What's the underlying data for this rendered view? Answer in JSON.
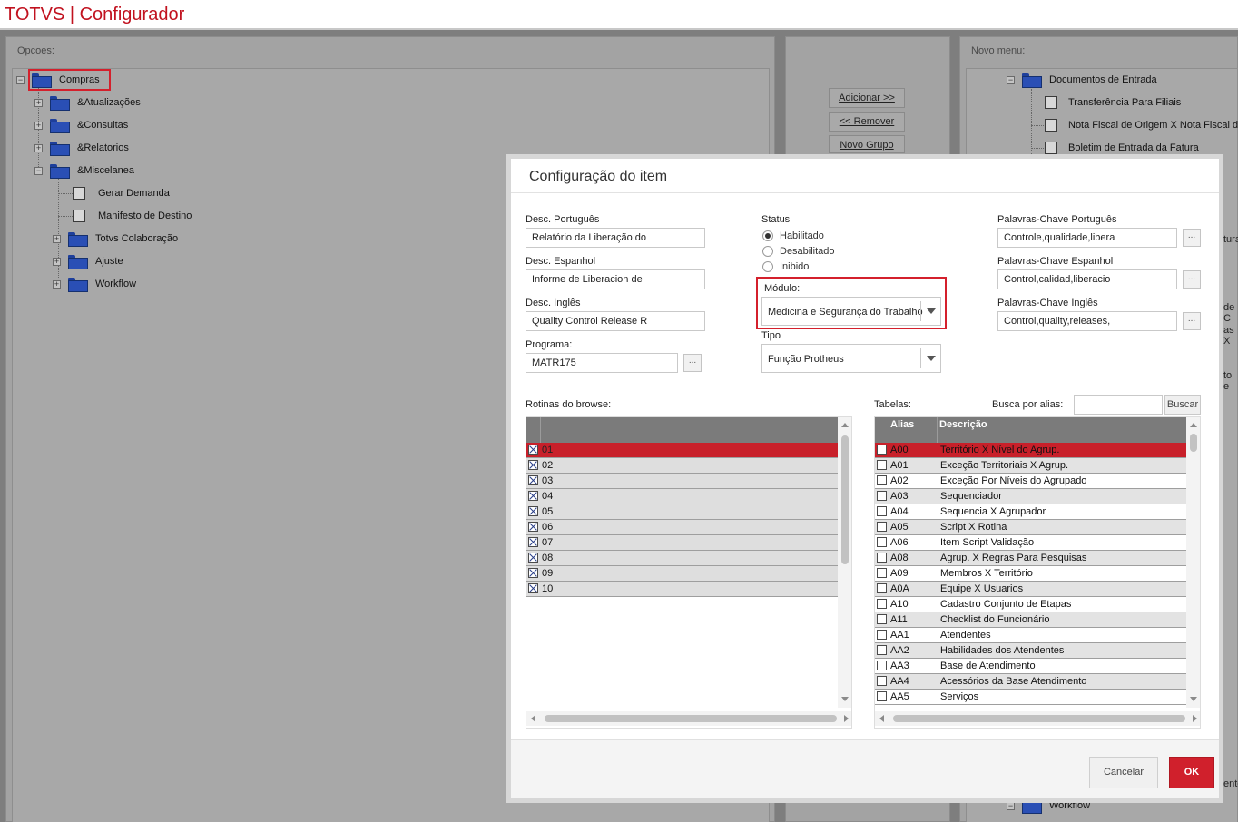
{
  "app": {
    "title": "TOTVS | Configurador"
  },
  "left_panel": {
    "header": "Opcoes:",
    "tree": {
      "root": "Compras",
      "items": [
        "&Atualizações",
        "&Consultas",
        "&Relatorios",
        "&Miscelanea"
      ],
      "miscelanea_children": [
        "Gerar Demanda",
        "Manifesto de Destino",
        "Totvs Colaboração",
        "Ajuste",
        "Workflow"
      ]
    }
  },
  "middle_panel": {
    "buttons": {
      "add": "Adicionar >>",
      "remove": "<< Remover",
      "new_group": "Novo Grupo"
    }
  },
  "right_panel": {
    "header": "Novo menu:",
    "folder": "Documentos de Entrada",
    "items": [
      "Transferência Para Filiais",
      "Nota Fiscal de Origem X Nota Fiscal de",
      "Boletim de Entrada da Fatura"
    ],
    "edge_fragments": [
      "tura",
      "de C",
      "as X",
      "to e",
      "ento"
    ],
    "bottom_folder": "Workflow"
  },
  "dialog": {
    "title": "Configuração do item",
    "desc_pt": {
      "label": "Desc. Português",
      "value": "Relatório da Liberação do"
    },
    "desc_es": {
      "label": "Desc. Espanhol",
      "value": "Informe de Liberacion de"
    },
    "desc_en": {
      "label": "Desc. Inglês",
      "value": "Quality Control Release R"
    },
    "programa": {
      "label": "Programa:",
      "value": "MATR175",
      "lookup": "..."
    },
    "status": {
      "label": "Status",
      "options": [
        "Habilitado",
        "Desabilitado",
        "Inibido"
      ],
      "selected": "Habilitado"
    },
    "modulo": {
      "label": "Módulo:",
      "value": "Medicina e Segurança do Trabalho"
    },
    "tipo": {
      "label": "Tipo",
      "value": "Função Protheus"
    },
    "kw_pt": {
      "label": "Palavras-Chave Português",
      "value": "Controle,qualidade,libera",
      "lookup": "..."
    },
    "kw_es": {
      "label": "Palavras-Chave Espanhol",
      "value": "Control,calidad,liberacio",
      "lookup": "..."
    },
    "kw_en": {
      "label": "Palavras-Chave Inglês",
      "value": "Control,quality,releases,",
      "lookup": "..."
    },
    "rotinas": {
      "label": "Rotinas do browse:",
      "rows": [
        "01",
        "02",
        "03",
        "04",
        "05",
        "06",
        "07",
        "08",
        "09",
        "10"
      ],
      "selected_row": "01"
    },
    "tabelas": {
      "label": "Tabelas:",
      "search_label": "Busca por alias:",
      "search_value": "",
      "search_button": "Buscar",
      "columns": [
        "Alias",
        "Descrição"
      ],
      "rows": [
        {
          "alias": "A00",
          "desc": "Território X Nível do Agrup."
        },
        {
          "alias": "A01",
          "desc": "Exceção Territoriais X Agrup."
        },
        {
          "alias": "A02",
          "desc": "Exceção Por Níveis do Agrupado"
        },
        {
          "alias": "A03",
          "desc": "Sequenciador"
        },
        {
          "alias": "A04",
          "desc": "Sequencia X Agrupador"
        },
        {
          "alias": "A05",
          "desc": "Script X Rotina"
        },
        {
          "alias": "A06",
          "desc": "Item Script Validação"
        },
        {
          "alias": "A08",
          "desc": "Agrup. X Regras Para Pesquisas"
        },
        {
          "alias": "A09",
          "desc": "Membros X Território"
        },
        {
          "alias": "A0A",
          "desc": "Equipe X Usuarios"
        },
        {
          "alias": "A10",
          "desc": "Cadastro Conjunto de Etapas"
        },
        {
          "alias": "A11",
          "desc": "Checklist do Funcionário"
        },
        {
          "alias": "AA1",
          "desc": "Atendentes"
        },
        {
          "alias": "AA2",
          "desc": "Habilidades dos Atendentes"
        },
        {
          "alias": "AA3",
          "desc": "Base de Atendimento"
        },
        {
          "alias": "AA4",
          "desc": "Acessórios da Base Atendimento"
        },
        {
          "alias": "AA5",
          "desc": "Serviços"
        }
      ]
    },
    "buttons": {
      "cancel": "Cancelar",
      "ok": "OK"
    }
  },
  "colors": {
    "brand_red": "#c1121f",
    "selection_red": "#c8202a",
    "ok_red": "#d0202c"
  }
}
